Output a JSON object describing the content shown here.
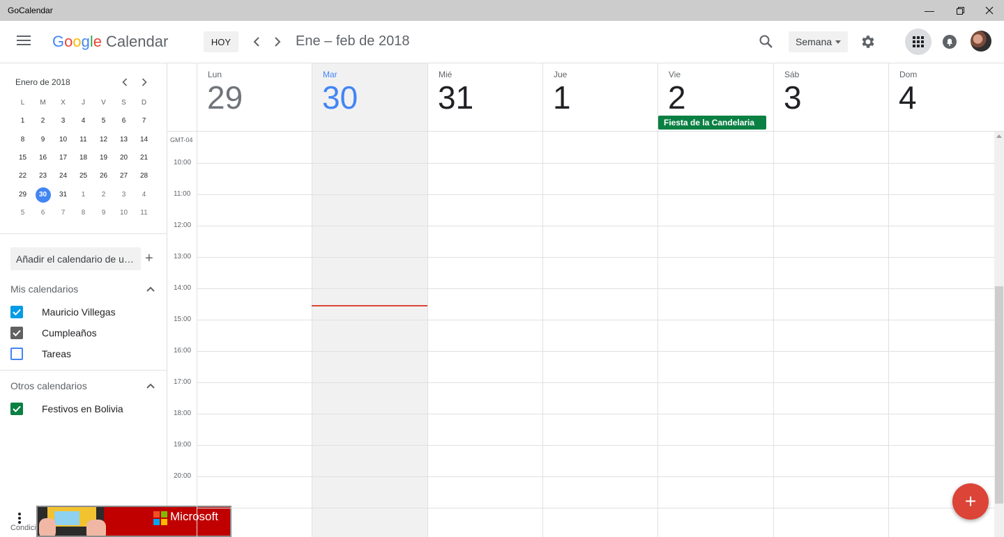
{
  "window": {
    "title": "GoCalendar"
  },
  "header": {
    "logo_google": "Google",
    "logo_calendar": "Calendar",
    "today_label": "HOY",
    "date_range": "Ene – feb de 2018",
    "view_label": "Semana"
  },
  "mini_calendar": {
    "title": "Enero de 2018",
    "weekdays": [
      "L",
      "M",
      "X",
      "J",
      "V",
      "S",
      "D"
    ],
    "weeks": [
      [
        "1",
        "2",
        "3",
        "4",
        "5",
        "6",
        "7"
      ],
      [
        "8",
        "9",
        "10",
        "11",
        "12",
        "13",
        "14"
      ],
      [
        "15",
        "16",
        "17",
        "18",
        "19",
        "20",
        "21"
      ],
      [
        "22",
        "23",
        "24",
        "25",
        "26",
        "27",
        "28"
      ],
      [
        "29",
        "30",
        "31",
        "1",
        "2",
        "3",
        "4"
      ],
      [
        "5",
        "6",
        "7",
        "8",
        "9",
        "10",
        "11"
      ]
    ],
    "today": "30"
  },
  "sidebar": {
    "add_calendar_placeholder": "Añadir el calendario de un a...",
    "my_calendars_title": "Mis calendarios",
    "my_calendars": [
      {
        "label": "Mauricio Villegas",
        "checked": true,
        "color": "#039be5"
      },
      {
        "label": "Cumpleaños",
        "checked": true,
        "color": "#616161"
      },
      {
        "label": "Tareas",
        "checked": false,
        "color": "#4285f4"
      }
    ],
    "other_calendars_title": "Otros calendarios",
    "other_calendars": [
      {
        "label": "Festivos en Bolivia",
        "checked": true,
        "color": "#0b8043"
      }
    ],
    "footer_text": "Condici",
    "ad_brand": "Microsoft"
  },
  "week": {
    "timezone": "GMT-04",
    "days": [
      {
        "name": "Lun",
        "num": "29",
        "state": "past"
      },
      {
        "name": "Mar",
        "num": "30",
        "state": "today"
      },
      {
        "name": "Mié",
        "num": "31",
        "state": "future"
      },
      {
        "name": "Jue",
        "num": "1",
        "state": "future"
      },
      {
        "name": "Vie",
        "num": "2",
        "state": "future"
      },
      {
        "name": "Sáb",
        "num": "3",
        "state": "future"
      },
      {
        "name": "Dom",
        "num": "4",
        "state": "future"
      }
    ],
    "hours": [
      "10:00",
      "11:00",
      "12:00",
      "13:00",
      "14:00",
      "15:00",
      "16:00",
      "17:00",
      "18:00",
      "19:00",
      "20:00"
    ],
    "all_day_event": {
      "title": "Fiesta de la Candelaria",
      "day_index": 4,
      "color": "#0b8043"
    }
  },
  "colors": {
    "accent": "#4285f4",
    "now_line": "#db4437",
    "fab": "#db4437"
  }
}
